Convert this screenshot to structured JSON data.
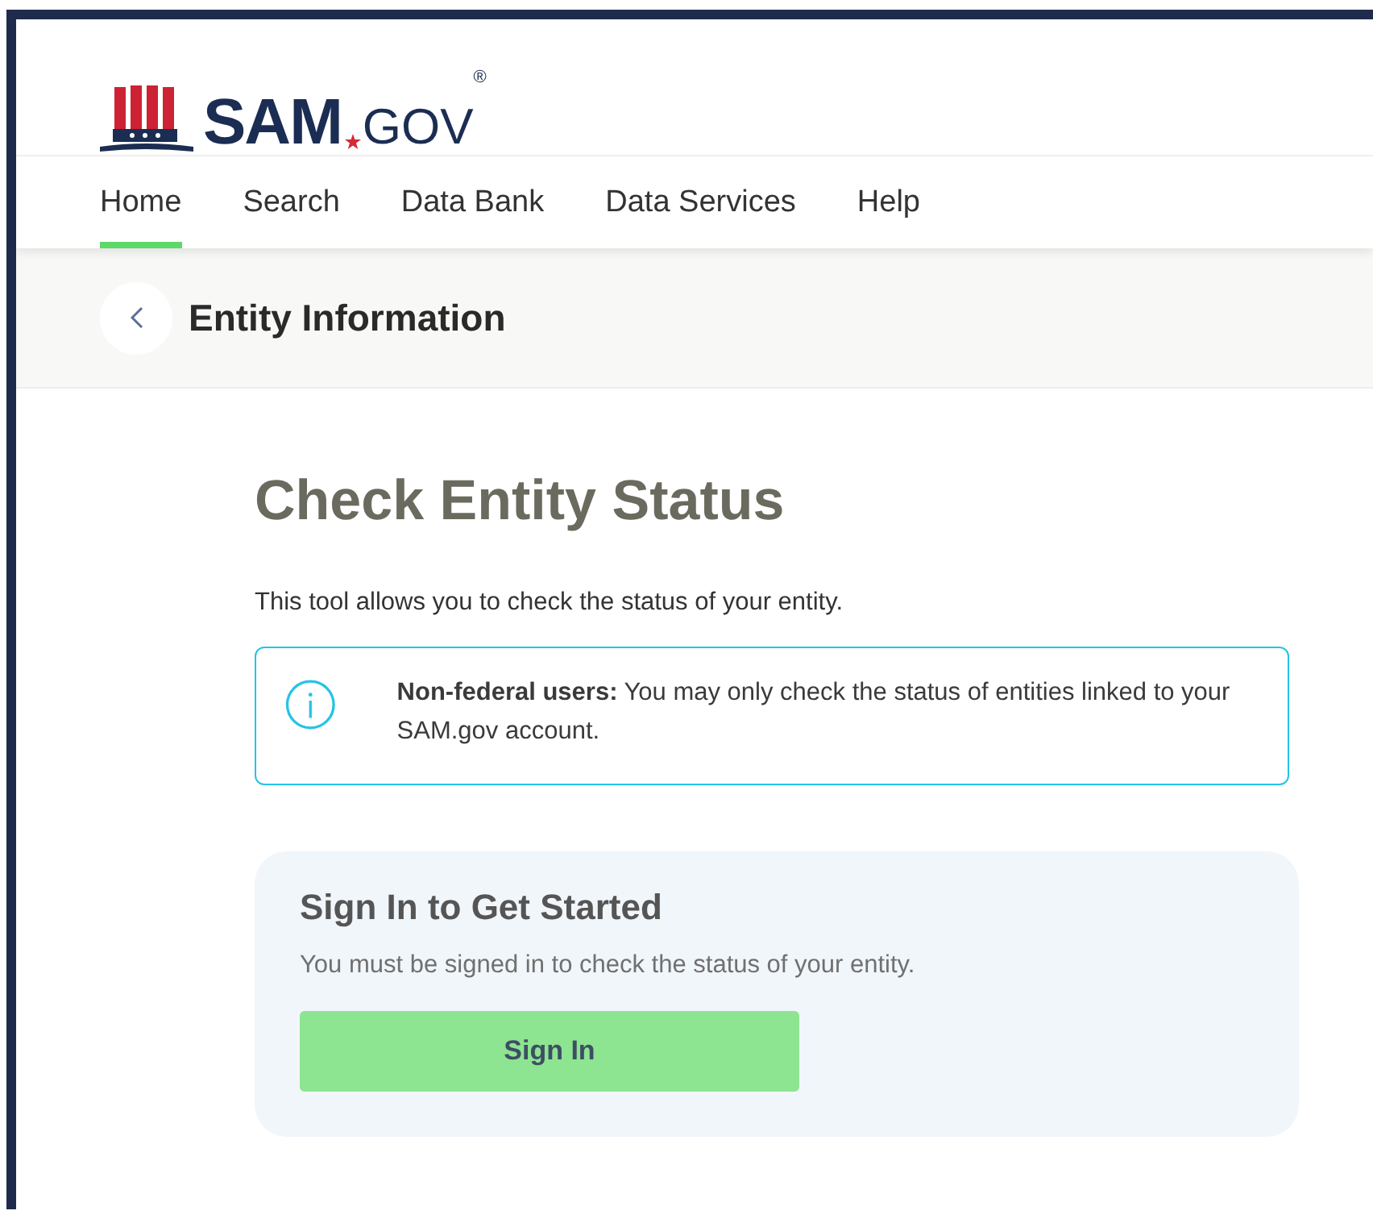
{
  "logo": {
    "name": "SAM",
    "suffix": "GOV",
    "mark": "®"
  },
  "nav": [
    {
      "label": "Home",
      "selected": true
    },
    {
      "label": "Search",
      "selected": false
    },
    {
      "label": "Data Bank",
      "selected": false
    },
    {
      "label": "Data Services",
      "selected": false
    },
    {
      "label": "Help",
      "selected": false
    }
  ],
  "page_header": {
    "title": "Entity Information"
  },
  "heading": "Check Entity Status",
  "description": "This tool allows you to check the status of your entity.",
  "alert": {
    "text": "**Non-federal users:** You may only check the status of entities linked to your SAM.gov account."
  },
  "card": {
    "title": "Sign In to Get Started",
    "text": "You must be signed in to check the status of your entity.",
    "button": "Sign In"
  }
}
